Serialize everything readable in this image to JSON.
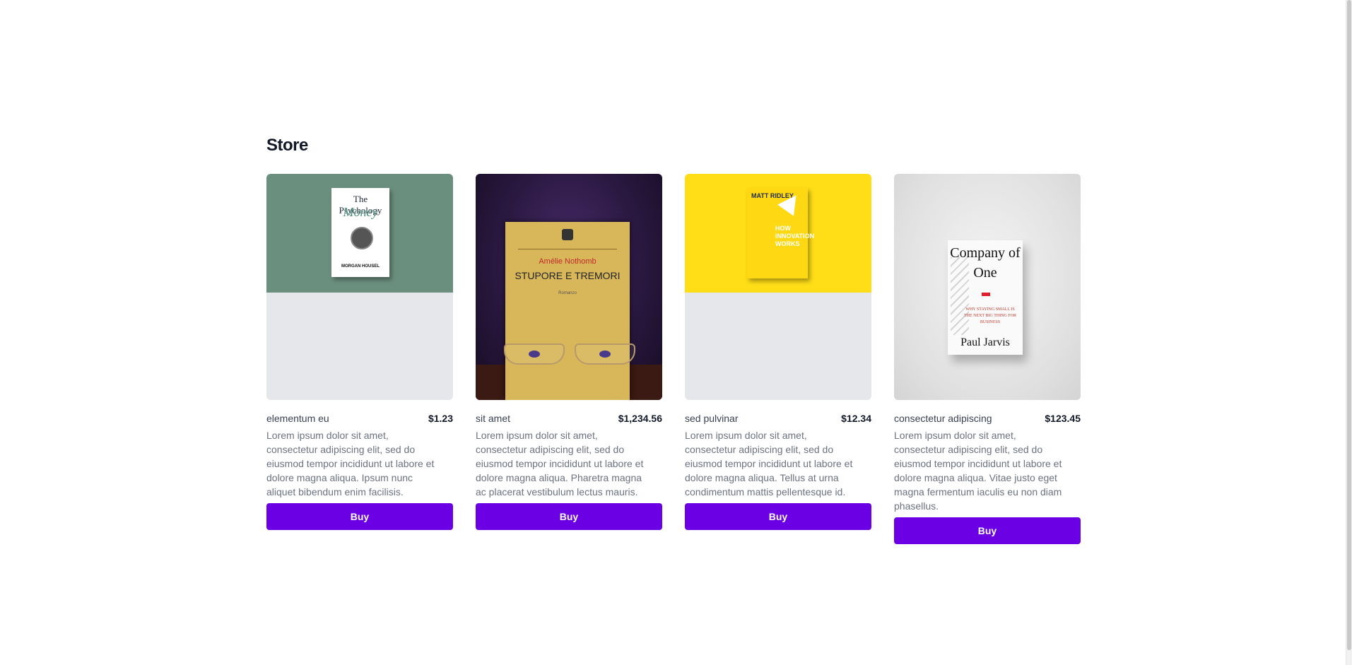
{
  "store": {
    "title": "Store",
    "buy_label": "Buy",
    "products": [
      {
        "name": "elementum eu",
        "price": "$1.23",
        "description": "Lorem ipsum dolor sit amet, consectetur adipiscing elit, sed do eiusmod tempor incididunt ut labore et dolore magna aliqua. Ipsum nunc aliquet bibendum enim facilisis.",
        "cover": {
          "background": "#6b8f7e",
          "title_line1": "The Psychology",
          "title_line2": "Money",
          "tagline": "TIMELESS LESSONS ON WEALTH, GREED, AND HAPPINESS",
          "author": "MORGAN HOUSEL"
        }
      },
      {
        "name": "sit amet",
        "price": "$1,234.56",
        "description": "Lorem ipsum dolor sit amet, consectetur adipiscing elit, sed do eiusmod tempor incididunt ut labore et dolore magna aliqua. Pharetra magna ac placerat vestibulum lectus mauris.",
        "cover": {
          "background": "#2a1840",
          "author": "Amélie Nothomb",
          "title": "STUPORE E TREMORI",
          "subtitle": "Romanzo"
        }
      },
      {
        "name": "sed pulvinar",
        "price": "$12.34",
        "description": "Lorem ipsum dolor sit amet, consectetur adipiscing elit, sed do eiusmod tempor incididunt ut labore et dolore magna aliqua. Tellus at urna condimentum mattis pellentesque id.",
        "cover": {
          "background": "#ffde17",
          "author": "MATT RIDLEY",
          "title": "HOW INNOVATION WORKS"
        }
      },
      {
        "name": "consectetur adipiscing",
        "price": "$123.45",
        "description": "Lorem ipsum dolor sit amet, consectetur adipiscing elit, sed do eiusmod tempor incididunt ut labore et dolore magna aliqua. Vitae justo eget magna fermentum iaculis eu non diam phasellus.",
        "cover": {
          "background": "#e4e4e4",
          "title": "Company of One",
          "subtitle": "WHY STAYING SMALL IS THE NEXT BIG THING FOR BUSINESS",
          "author": "Paul Jarvis"
        }
      }
    ]
  },
  "colors": {
    "button": "#6a00e3",
    "placeholder": "#e5e7eb"
  }
}
